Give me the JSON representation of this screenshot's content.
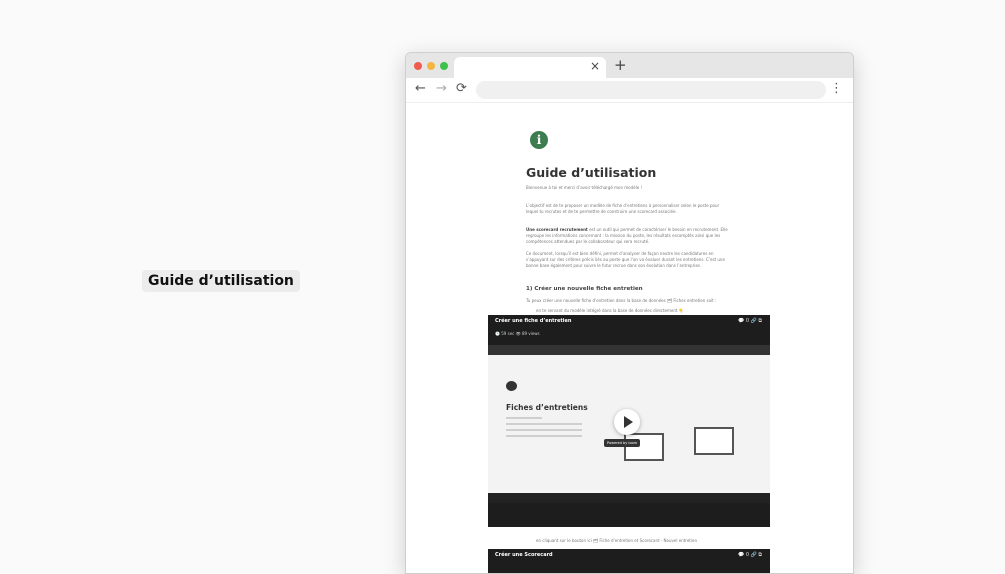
{
  "side_label": "Guide d’utilisation",
  "browser": {
    "tab_close": "×",
    "new_tab": "+",
    "nav": {
      "back": "←",
      "forward": "→",
      "reload": "⟳",
      "menu": "⋮"
    }
  },
  "document": {
    "icon": "i",
    "title": "Guide d’utilisation",
    "welcome": "Bienvenue à toi et merci d’avoir téléchargé mon modèle !",
    "paragraph1": "L’objectif est de te proposer un modèle de fiche d’entretiens à personnaliser selon le poste pour lequel tu recrutes et de te permettre de construire une scorecard associée.",
    "paragraph2_strong": "Une scorecard recrutement",
    "paragraph2": " est un outil qui permet de caractériser le besoin en recrutement. Elle regroupe les informations concernant : la mission du poste, les résultats escomptés ainsi que les compétences attendues par le collaborateur qui sera recruté.",
    "paragraph3": "Ce document, lorsqu’il est bien défini, permet d’analyser de façon neutre les candidatures en s’appuyant sur des critères précis liés au poste que l’on va évaluer durant les entretiens. C’est une bonne base également pour suivre le futur recrue dans son évolution dans l’entreprise.",
    "section1_title": "1) Créer une nouvelle fiche entretien",
    "section1_intro": "Tu peux créer une nouvelle fiche d’entretien dans la base de données 🗂 Fiches entretien soit :",
    "bullet1": "en te servant du modèle intégré dans la base de données directement 👇",
    "bullet2": "en cliquant sur le bouton ici 🗂 Fiche d’entretien et Scorecard - Nouvel entretien",
    "video1": {
      "title": "Créer une fiche d’entretien",
      "meta": "🕒 59 sec   👁 89 views",
      "controls": "💬 0   🔗   ⧉",
      "heading": "Fiches d’entretiens",
      "powered": "Powered by loom"
    },
    "video2": {
      "title": "Créer une Scorecard",
      "controls": "💬 0   🔗   ⧉"
    }
  }
}
